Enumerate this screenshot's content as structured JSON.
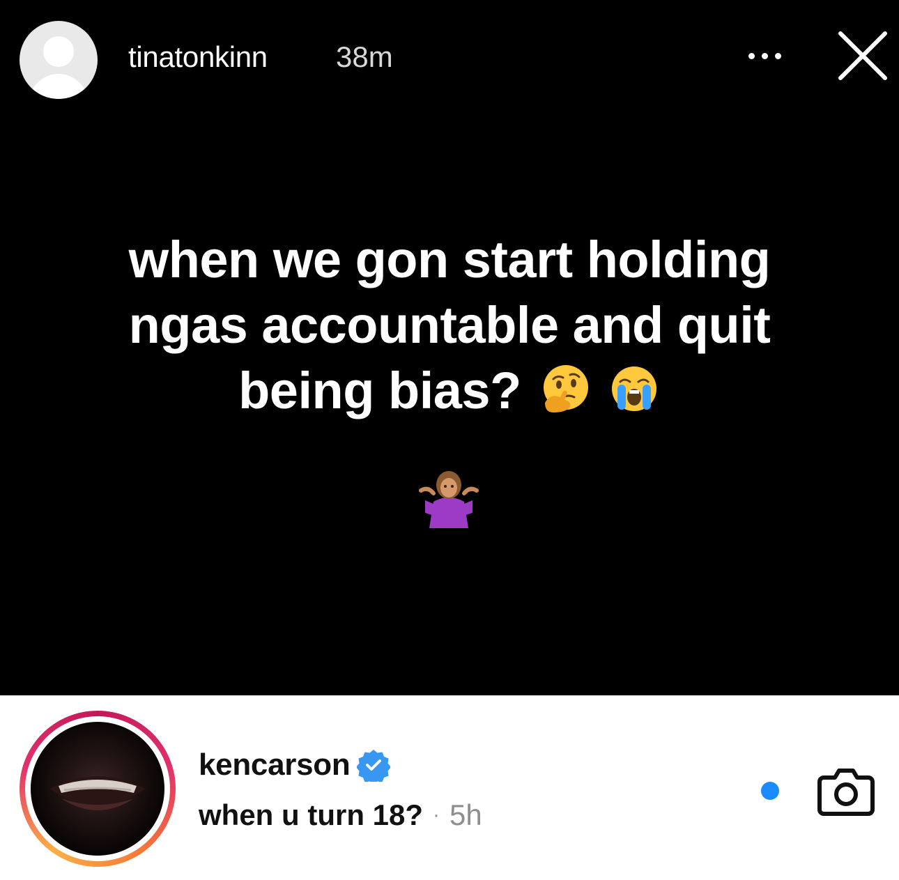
{
  "story": {
    "username": "tinatonkinn",
    "time_ago": "38m",
    "text_line1": "when we gon start holding",
    "text_line2": "ngas accountable and quit",
    "text_line3": "being bias?",
    "inline_emojis": [
      "thinking-face-icon",
      "loudly-crying-face-icon"
    ],
    "sticker_emoji": "person-shrugging-icon",
    "icons": {
      "more": "more-options-icon",
      "close": "close-icon",
      "avatar": "default-avatar-icon"
    }
  },
  "reply": {
    "username": "kencarson",
    "verified": true,
    "message": "when u turn 18?",
    "separator": "·",
    "time_ago": "5h",
    "icons": {
      "verified": "verified-badge-icon",
      "unread": "unread-dot-icon",
      "camera": "camera-icon"
    },
    "colors": {
      "unread_dot": "#1a8cff",
      "verified": "#3897f0",
      "story_ring": "#e1306c"
    }
  }
}
